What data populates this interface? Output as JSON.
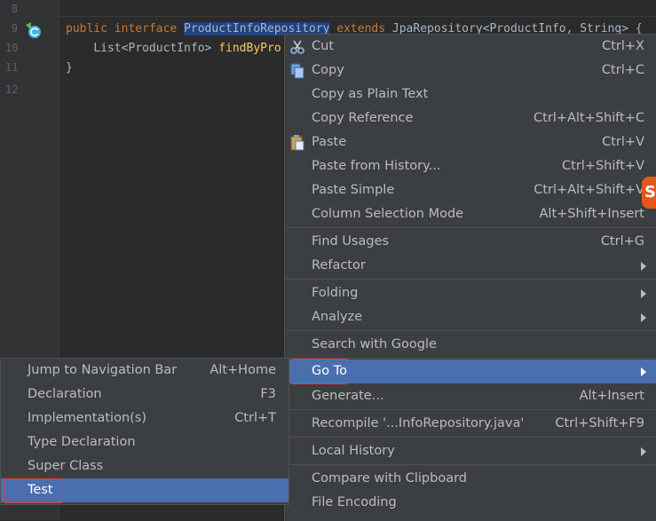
{
  "editor": {
    "line_numbers": [
      "8",
      "9",
      "10",
      "11",
      "12"
    ],
    "line9": {
      "kw_public": "public",
      "kw_interface": "interface",
      "selected": "ProductInfoRepository",
      "kw_extends": "extends",
      "rest": "JpaRepository<ProductInfo, String> {"
    },
    "line10": {
      "type": "List<ProductInfo>",
      "method": "findByPro"
    },
    "line11": "}"
  },
  "context_menu": {
    "items": [
      {
        "label": "Cut",
        "shortcut": "Ctrl+X",
        "icon": "scissors-icon"
      },
      {
        "label": "Copy",
        "shortcut": "Ctrl+C",
        "icon": "copy-icon"
      },
      {
        "label": "Copy as Plain Text",
        "shortcut": ""
      },
      {
        "label": "Copy Reference",
        "shortcut": "Ctrl+Alt+Shift+C"
      },
      {
        "label": "Paste",
        "shortcut": "Ctrl+V",
        "icon": "clipboard-icon"
      },
      {
        "label": "Paste from History...",
        "shortcut": "Ctrl+Shift+V"
      },
      {
        "label": "Paste Simple",
        "shortcut": "Ctrl+Alt+Shift+V"
      },
      {
        "label": "Column Selection Mode",
        "shortcut": "Alt+Shift+Insert"
      },
      {
        "label": "Find Usages",
        "shortcut": "Ctrl+G"
      },
      {
        "label": "Refactor",
        "submenu": true
      },
      {
        "label": "Folding",
        "submenu": true
      },
      {
        "label": "Analyze",
        "submenu": true
      },
      {
        "label": "Search with Google",
        "shortcut": ""
      },
      {
        "label": "Go To",
        "submenu": true,
        "highlighted": true
      },
      {
        "label": "Generate...",
        "shortcut": "Alt+Insert"
      },
      {
        "label": "Recompile '...InfoRepository.java'",
        "shortcut": "Ctrl+Shift+F9"
      },
      {
        "label": "Local History",
        "submenu": true
      },
      {
        "label": "Compare with Clipboard",
        "shortcut": ""
      },
      {
        "label": "File Encoding",
        "shortcut": ""
      }
    ]
  },
  "goto_submenu": {
    "items": [
      {
        "label": "Jump to Navigation Bar",
        "shortcut": "Alt+Home"
      },
      {
        "label": "Declaration",
        "shortcut": "F3"
      },
      {
        "label": "Implementation(s)",
        "shortcut": "Ctrl+T"
      },
      {
        "label": "Type Declaration",
        "shortcut": ""
      },
      {
        "label": "Super Class",
        "shortcut": ""
      },
      {
        "label": "Test",
        "shortcut": "",
        "highlighted": true
      }
    ]
  },
  "badge": {
    "letter": "S"
  },
  "colors": {
    "editor_bg": "#2b2b2b",
    "menu_bg": "#3c3f41",
    "highlight": "#4b6eaf",
    "keyword": "#cc7832",
    "annotation_box": "#e04040"
  }
}
